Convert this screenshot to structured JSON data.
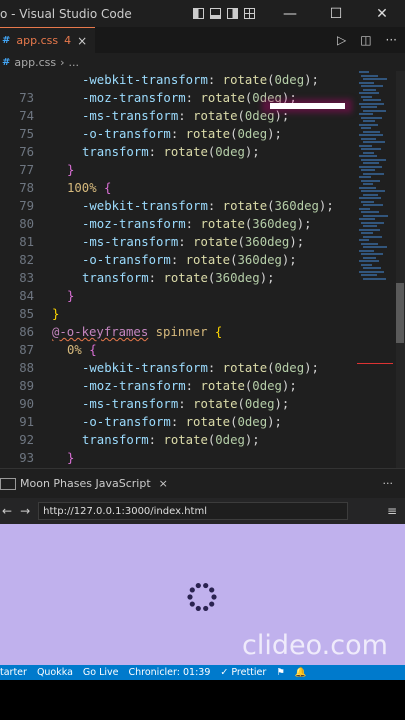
{
  "window": {
    "title": "o - Visual Studio Code",
    "controls": {
      "minimize": "—",
      "maximize": "☐",
      "close": "✕"
    }
  },
  "tab": {
    "filename": "app.css",
    "problems": "4",
    "close": "×"
  },
  "breadcrumb": {
    "hash": "#",
    "file": "app.css",
    "more": "..."
  },
  "editor": {
    "lines": [
      {
        "num": "",
        "tokens": [
          [
            "c-prop",
            "-webkit-transform"
          ],
          [
            "c-punc",
            ": "
          ],
          [
            "c-fn",
            "rotate"
          ],
          [
            "c-punc",
            "("
          ],
          [
            "c-num",
            "0deg"
          ],
          [
            "c-punc",
            ");"
          ]
        ],
        "indent": 2
      },
      {
        "num": "73",
        "tokens": [
          [
            "c-prop",
            "-moz-transform"
          ],
          [
            "c-punc",
            ": "
          ],
          [
            "c-fn",
            "rotate"
          ],
          [
            "c-punc",
            "("
          ],
          [
            "c-num",
            "0deg"
          ],
          [
            "c-punc",
            ");"
          ]
        ],
        "indent": 2
      },
      {
        "num": "74",
        "tokens": [
          [
            "c-prop",
            "-ms-transform"
          ],
          [
            "c-punc",
            ": "
          ],
          [
            "c-fn",
            "rotate"
          ],
          [
            "c-punc",
            "("
          ],
          [
            "c-num",
            "0deg"
          ],
          [
            "c-punc",
            ");"
          ]
        ],
        "indent": 2
      },
      {
        "num": "75",
        "tokens": [
          [
            "c-prop",
            "-o-transform"
          ],
          [
            "c-punc",
            ": "
          ],
          [
            "c-fn",
            "rotate"
          ],
          [
            "c-punc",
            "("
          ],
          [
            "c-num",
            "0deg"
          ],
          [
            "c-punc",
            ");"
          ]
        ],
        "indent": 2
      },
      {
        "num": "76",
        "tokens": [
          [
            "c-prop",
            "transform"
          ],
          [
            "c-punc",
            ": "
          ],
          [
            "c-fn",
            "rotate"
          ],
          [
            "c-punc",
            "("
          ],
          [
            "c-num",
            "0deg"
          ],
          [
            "c-punc",
            ");"
          ]
        ],
        "indent": 2
      },
      {
        "num": "77",
        "tokens": [
          [
            "c-br2",
            "}"
          ]
        ],
        "indent": 1
      },
      {
        "num": "78",
        "tokens": [
          [
            "c-sel",
            "100%"
          ],
          [
            "c-punc",
            " "
          ],
          [
            "c-br2",
            "{"
          ]
        ],
        "indent": 1
      },
      {
        "num": "79",
        "tokens": [
          [
            "c-prop",
            "-webkit-transform"
          ],
          [
            "c-punc",
            ": "
          ],
          [
            "c-fn",
            "rotate"
          ],
          [
            "c-punc",
            "("
          ],
          [
            "c-num",
            "360deg"
          ],
          [
            "c-punc",
            ");"
          ]
        ],
        "indent": 2
      },
      {
        "num": "80",
        "tokens": [
          [
            "c-prop",
            "-moz-transform"
          ],
          [
            "c-punc",
            ": "
          ],
          [
            "c-fn",
            "rotate"
          ],
          [
            "c-punc",
            "("
          ],
          [
            "c-num",
            "360deg"
          ],
          [
            "c-punc",
            ");"
          ]
        ],
        "indent": 2
      },
      {
        "num": "81",
        "tokens": [
          [
            "c-prop",
            "-ms-transform"
          ],
          [
            "c-punc",
            ": "
          ],
          [
            "c-fn",
            "rotate"
          ],
          [
            "c-punc",
            "("
          ],
          [
            "c-num",
            "360deg"
          ],
          [
            "c-punc",
            ");"
          ]
        ],
        "indent": 2
      },
      {
        "num": "82",
        "tokens": [
          [
            "c-prop",
            "-o-transform"
          ],
          [
            "c-punc",
            ": "
          ],
          [
            "c-fn",
            "rotate"
          ],
          [
            "c-punc",
            "("
          ],
          [
            "c-num",
            "360deg"
          ],
          [
            "c-punc",
            ");"
          ]
        ],
        "indent": 2
      },
      {
        "num": "83",
        "tokens": [
          [
            "c-prop",
            "transform"
          ],
          [
            "c-punc",
            ": "
          ],
          [
            "c-fn",
            "rotate"
          ],
          [
            "c-punc",
            "("
          ],
          [
            "c-num",
            "360deg"
          ],
          [
            "c-punc",
            ");"
          ]
        ],
        "indent": 2
      },
      {
        "num": "84",
        "tokens": [
          [
            "c-br2",
            "}"
          ]
        ],
        "indent": 1
      },
      {
        "num": "85",
        "tokens": [
          [
            "c-br",
            "}"
          ]
        ],
        "indent": 0
      },
      {
        "num": "86",
        "tokens": [
          [
            "c-at squig",
            "@-o-keyframes"
          ],
          [
            "c-punc",
            " "
          ],
          [
            "c-sel",
            "spinner"
          ],
          [
            "c-punc",
            " "
          ],
          [
            "c-br",
            "{"
          ]
        ],
        "indent": 0
      },
      {
        "num": "87",
        "tokens": [
          [
            "c-sel",
            "0%"
          ],
          [
            "c-punc",
            " "
          ],
          [
            "c-br2",
            "{"
          ]
        ],
        "indent": 1
      },
      {
        "num": "88",
        "tokens": [
          [
            "c-prop",
            "-webkit-transform"
          ],
          [
            "c-punc",
            ": "
          ],
          [
            "c-fn",
            "rotate"
          ],
          [
            "c-punc",
            "("
          ],
          [
            "c-num",
            "0deg"
          ],
          [
            "c-punc",
            ");"
          ]
        ],
        "indent": 2
      },
      {
        "num": "89",
        "tokens": [
          [
            "c-prop",
            "-moz-transform"
          ],
          [
            "c-punc",
            ": "
          ],
          [
            "c-fn",
            "rotate"
          ],
          [
            "c-punc",
            "("
          ],
          [
            "c-num",
            "0deg"
          ],
          [
            "c-punc",
            ");"
          ]
        ],
        "indent": 2
      },
      {
        "num": "90",
        "tokens": [
          [
            "c-prop",
            "-ms-transform"
          ],
          [
            "c-punc",
            ": "
          ],
          [
            "c-fn",
            "rotate"
          ],
          [
            "c-punc",
            "("
          ],
          [
            "c-num",
            "0deg"
          ],
          [
            "c-punc",
            ");"
          ]
        ],
        "indent": 2
      },
      {
        "num": "91",
        "tokens": [
          [
            "c-prop",
            "-o-transform"
          ],
          [
            "c-punc",
            ": "
          ],
          [
            "c-fn",
            "rotate"
          ],
          [
            "c-punc",
            "("
          ],
          [
            "c-num",
            "0deg"
          ],
          [
            "c-punc",
            ");"
          ]
        ],
        "indent": 2
      },
      {
        "num": "92",
        "tokens": [
          [
            "c-prop",
            "transform"
          ],
          [
            "c-punc",
            ": "
          ],
          [
            "c-fn",
            "rotate"
          ],
          [
            "c-punc",
            "("
          ],
          [
            "c-num",
            "0deg"
          ],
          [
            "c-punc",
            ");"
          ]
        ],
        "indent": 2
      },
      {
        "num": "93",
        "tokens": [
          [
            "c-br2",
            "}"
          ]
        ],
        "indent": 1
      }
    ]
  },
  "panel": {
    "title": "Moon Phases JavaScript",
    "close": "×",
    "more": "···"
  },
  "browser": {
    "back": "←",
    "forward": "→",
    "url": "http://127.0.0.1:3000/index.html",
    "menu": "≡"
  },
  "preview": {
    "watermark": "clideo.com",
    "background": "#c0b1ed"
  },
  "status": {
    "items": [
      "tarter",
      "Quokka",
      "Go Live",
      "Chronicler: 01:39",
      "✓ Prettier"
    ]
  },
  "colors": {
    "accent": "#007acc",
    "tab_modified": "#e8794c"
  }
}
